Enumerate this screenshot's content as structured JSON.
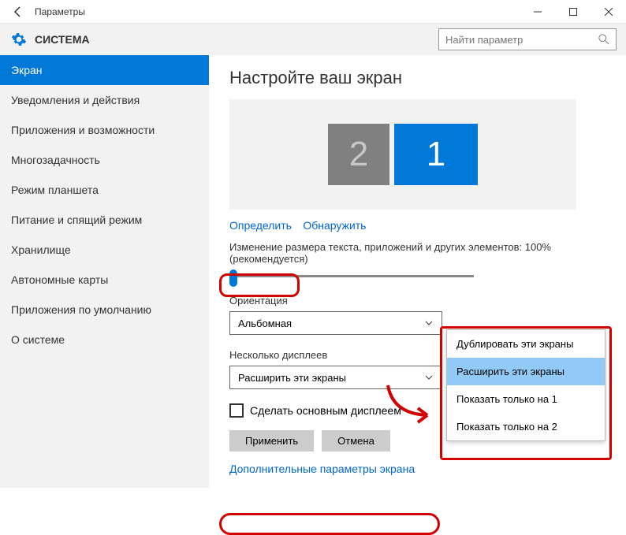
{
  "window": {
    "title": "Параметры"
  },
  "header": {
    "section": "СИСТЕМА",
    "search_placeholder": "Найти параметр"
  },
  "sidebar": {
    "items": [
      "Экран",
      "Уведомления и действия",
      "Приложения и возможности",
      "Многозадачность",
      "Режим планшета",
      "Питание и спящий режим",
      "Хранилище",
      "Автономные карты",
      "Приложения по умолчанию",
      "О системе"
    ],
    "active_index": 0
  },
  "main": {
    "title": "Настройте ваш экран",
    "monitors": {
      "primary": "1",
      "secondary": "2"
    },
    "identify_link": "Определить",
    "detect_link": "Обнаружить",
    "scale_label": "Изменение размера текста, приложений и других элементов: 100% (рекомендуется)",
    "orientation_label": "Ориентация",
    "orientation_value": "Альбомная",
    "multi_label": "Несколько дисплеев",
    "multi_value": "Расширить эти экраны",
    "make_primary": "Сделать основным дисплеем",
    "apply_btn": "Применить",
    "cancel_btn": "Отмена",
    "advanced_link": "Дополнительные параметры экрана"
  },
  "dropdown": {
    "options": [
      "Дублировать эти экраны",
      "Расширить эти экраны",
      "Показать только на 1",
      "Показать только на 2"
    ],
    "selected_index": 1
  }
}
